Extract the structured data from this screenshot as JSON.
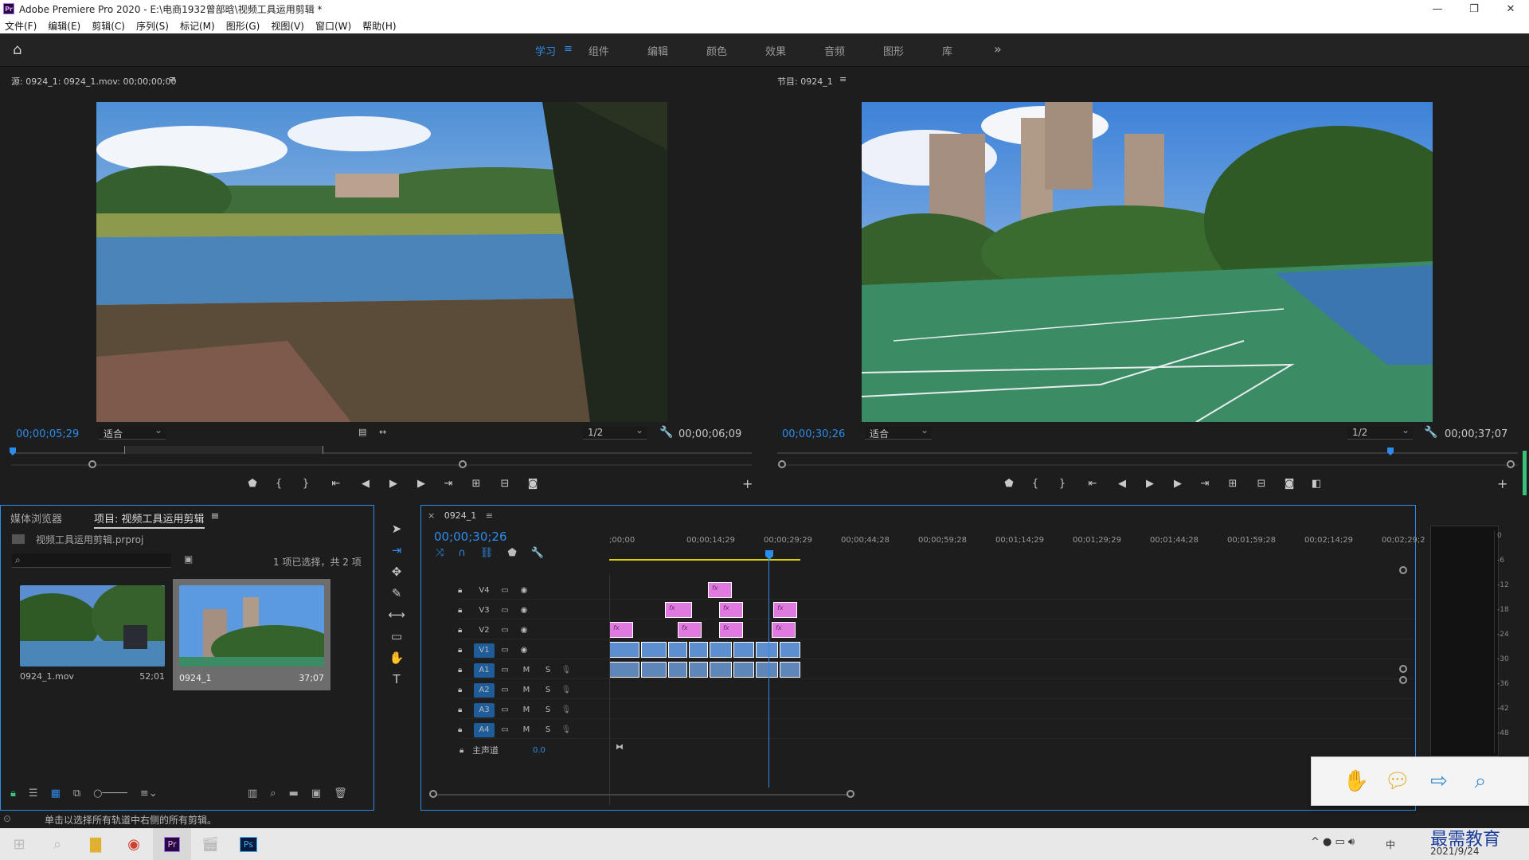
{
  "window": {
    "app_icon": "Pr",
    "title": "Adobe Premiere Pro 2020 - E:\\电商1932曾部晗\\视频工具运用剪辑 *",
    "controls": [
      "—",
      "❐",
      "✕"
    ]
  },
  "menu": [
    "文件(F)",
    "编辑(E)",
    "剪辑(C)",
    "序列(S)",
    "标记(M)",
    "图形(G)",
    "视图(V)",
    "窗口(W)",
    "帮助(H)"
  ],
  "workspaces": {
    "tabs": [
      "学习",
      "组件",
      "编辑",
      "颜色",
      "效果",
      "音频",
      "图形",
      "库"
    ],
    "active": "学习",
    "more": "»"
  },
  "source": {
    "label": "源: 0924_1: 0924_1.mov: 00;00;00;00",
    "timecode": "00;00;05;29",
    "fit": "适合",
    "resolution": "1/2",
    "duration": "00;00;06;09"
  },
  "program": {
    "label": "节目: 0924_1",
    "timecode": "00;00;30;26",
    "fit": "适合",
    "resolution": "1/2",
    "duration": "00;00;37;07"
  },
  "project": {
    "tabs": [
      "媒体浏览器",
      "项目: 视频工具运用剪辑"
    ],
    "active_tab": "项目: 视频工具运用剪辑",
    "file": "视频工具运用剪辑.prproj",
    "selection": "1 项已选择，共 2 项",
    "items": [
      {
        "name": "0924_1.mov",
        "duration": "52;01"
      },
      {
        "name": "0924_1",
        "duration": "37;07"
      }
    ]
  },
  "timeline": {
    "tab": "0924_1",
    "timecode": "00;00;30;26",
    "ruler": [
      ";00;00",
      "00;00;14;29",
      "00;00;29;29",
      "00;00;44;28",
      "00;00;59;28",
      "00;01;14;29",
      "00;01;29;29",
      "00;01;44;28",
      "00;01;59;28",
      "00;02;14;29",
      "00;02;29;2"
    ],
    "video_tracks": [
      "V4",
      "V3",
      "V2",
      "V1"
    ],
    "audio_tracks": [
      "A1",
      "A2",
      "A3",
      "A4"
    ],
    "master": "主声道",
    "master_value": "0.0",
    "mute_label": "M",
    "solo_label": "S",
    "fx_label": "fx"
  },
  "vu_scale": [
    "0",
    "-6",
    "-12",
    "-18",
    "-24",
    "-30",
    "-36",
    "-42",
    "-48"
  ],
  "status": "单击以选择所有轨道中右侧的所有剪辑。",
  "taskbar": {
    "date": "2021/9/24",
    "ime": "中",
    "watermark": "最需教育"
  },
  "colors": {
    "accent": "#2d8ceb",
    "panel": "#1d1d1d",
    "fx_clip": "#e07ae0",
    "video_clip": "#5c8ed0",
    "audio_clip": "#5f86b8"
  }
}
